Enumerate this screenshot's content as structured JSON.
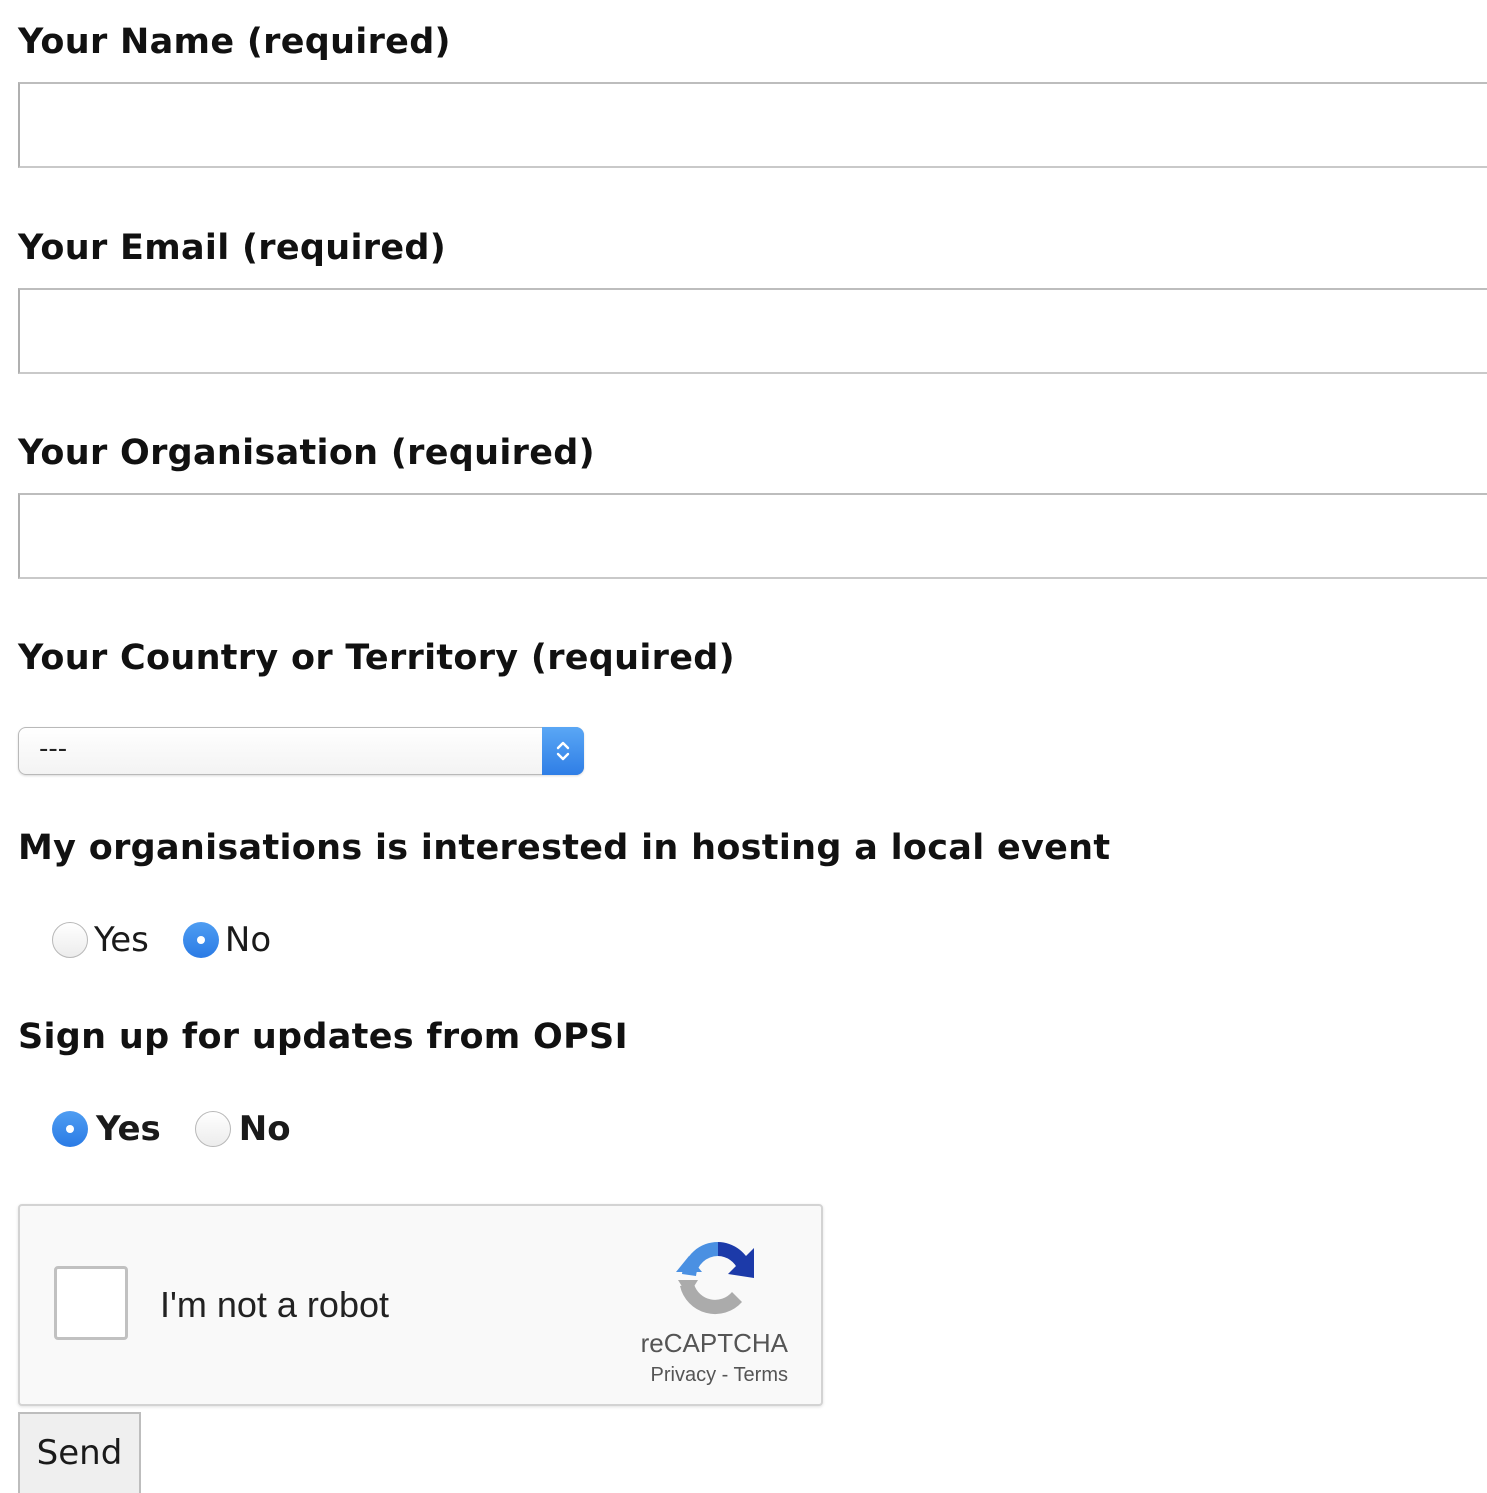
{
  "form": {
    "name_label": "Your Name (required)",
    "name_value": "",
    "email_label": "Your Email (required)",
    "email_value": "",
    "organisation_label": "Your Organisation (required)",
    "organisation_value": "",
    "country_label": "Your Country or Territory (required)",
    "country_selected": "---",
    "hosting_label": "My organisations is interested in hosting a local event",
    "hosting_options": [
      {
        "label": "Yes",
        "checked": false
      },
      {
        "label": "No",
        "checked": true
      }
    ],
    "updates_label": "Sign up for updates from OPSI",
    "updates_options": [
      {
        "label": "Yes",
        "checked": true
      },
      {
        "label": "No",
        "checked": false
      }
    ],
    "send_label": "Send"
  },
  "recaptcha": {
    "label": "I'm not a robot",
    "brand": "reCAPTCHA",
    "privacy": "Privacy",
    "separator": "-",
    "terms": "Terms",
    "checked": false
  },
  "colors": {
    "radio_checked": "#2b7be5",
    "select_arrow": "#3b8aec",
    "recaptcha_blue": "#4a90e2",
    "recaptcha_dark_blue": "#1c3aa9",
    "recaptcha_gray": "#ababab"
  }
}
